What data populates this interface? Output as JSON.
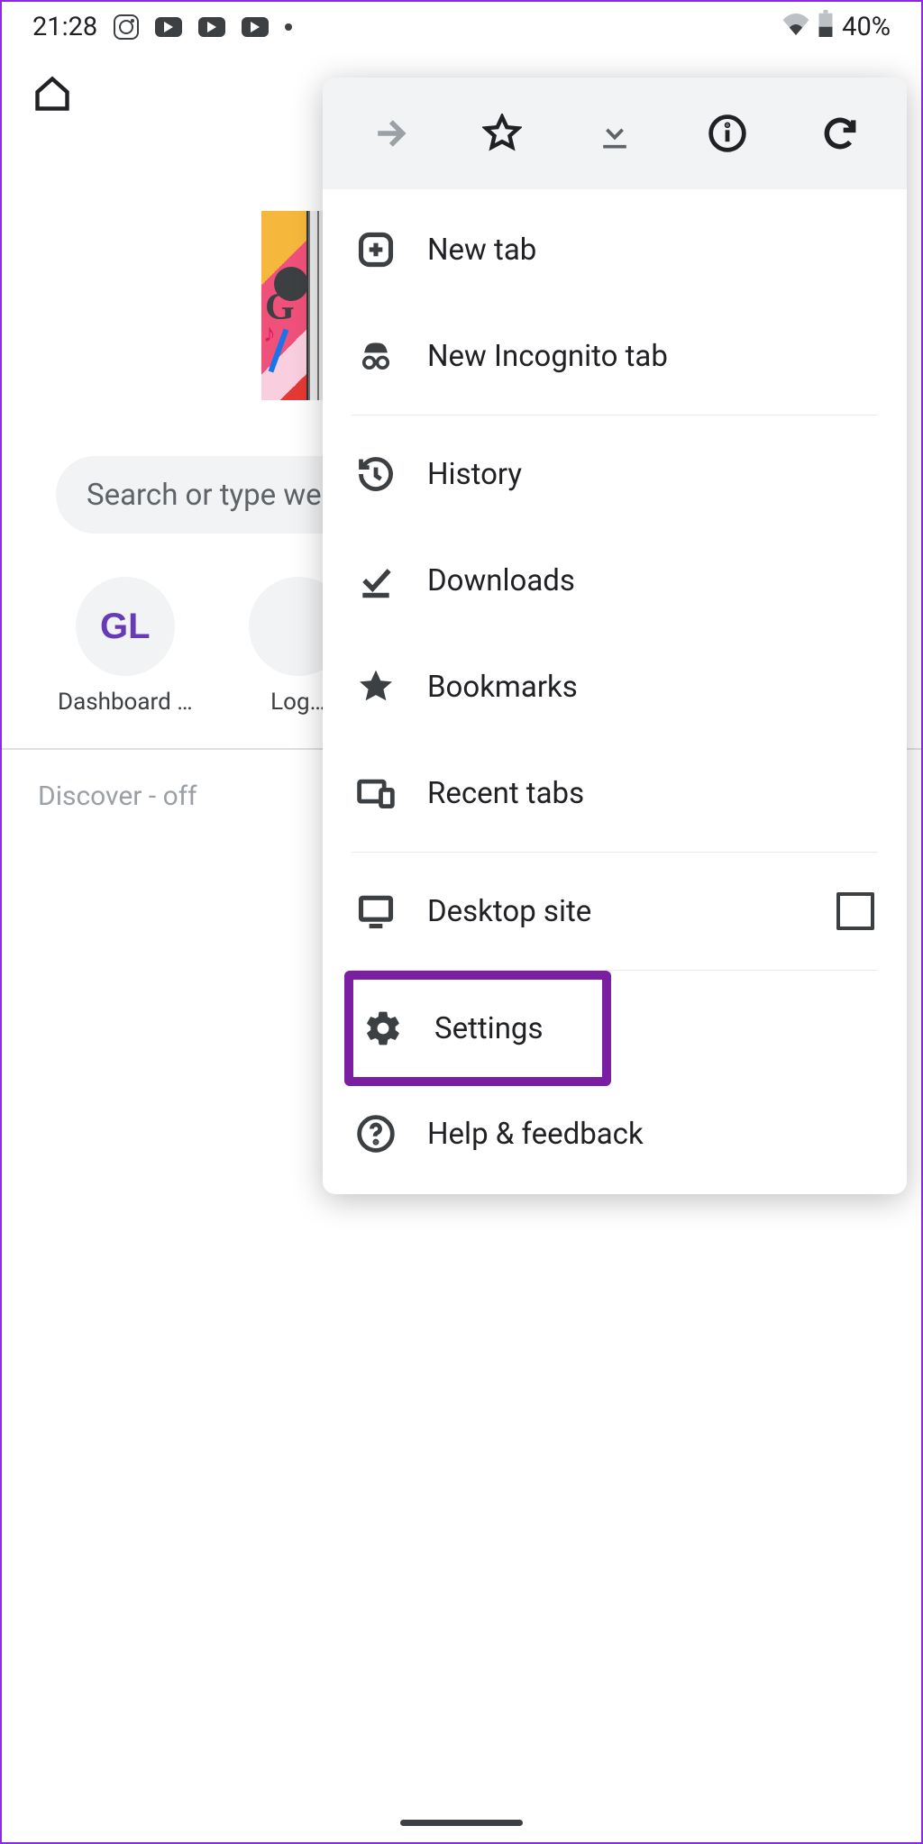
{
  "status": {
    "time": "21:28",
    "battery": "40%"
  },
  "search": {
    "placeholder": "Search or type web address"
  },
  "shortcuts": [
    {
      "label": "Dashboard …",
      "initial": "GL"
    },
    {
      "label": "Log…",
      "initial": ""
    }
  ],
  "discover": {
    "label": "Discover - off"
  },
  "menu": {
    "items": {
      "new_tab": "New tab",
      "incognito": "New Incognito tab",
      "history": "History",
      "downloads": "Downloads",
      "bookmarks": "Bookmarks",
      "recent_tabs": "Recent tabs",
      "desktop_site": "Desktop site",
      "settings": "Settings",
      "help": "Help & feedback"
    }
  },
  "highlight": "settings"
}
